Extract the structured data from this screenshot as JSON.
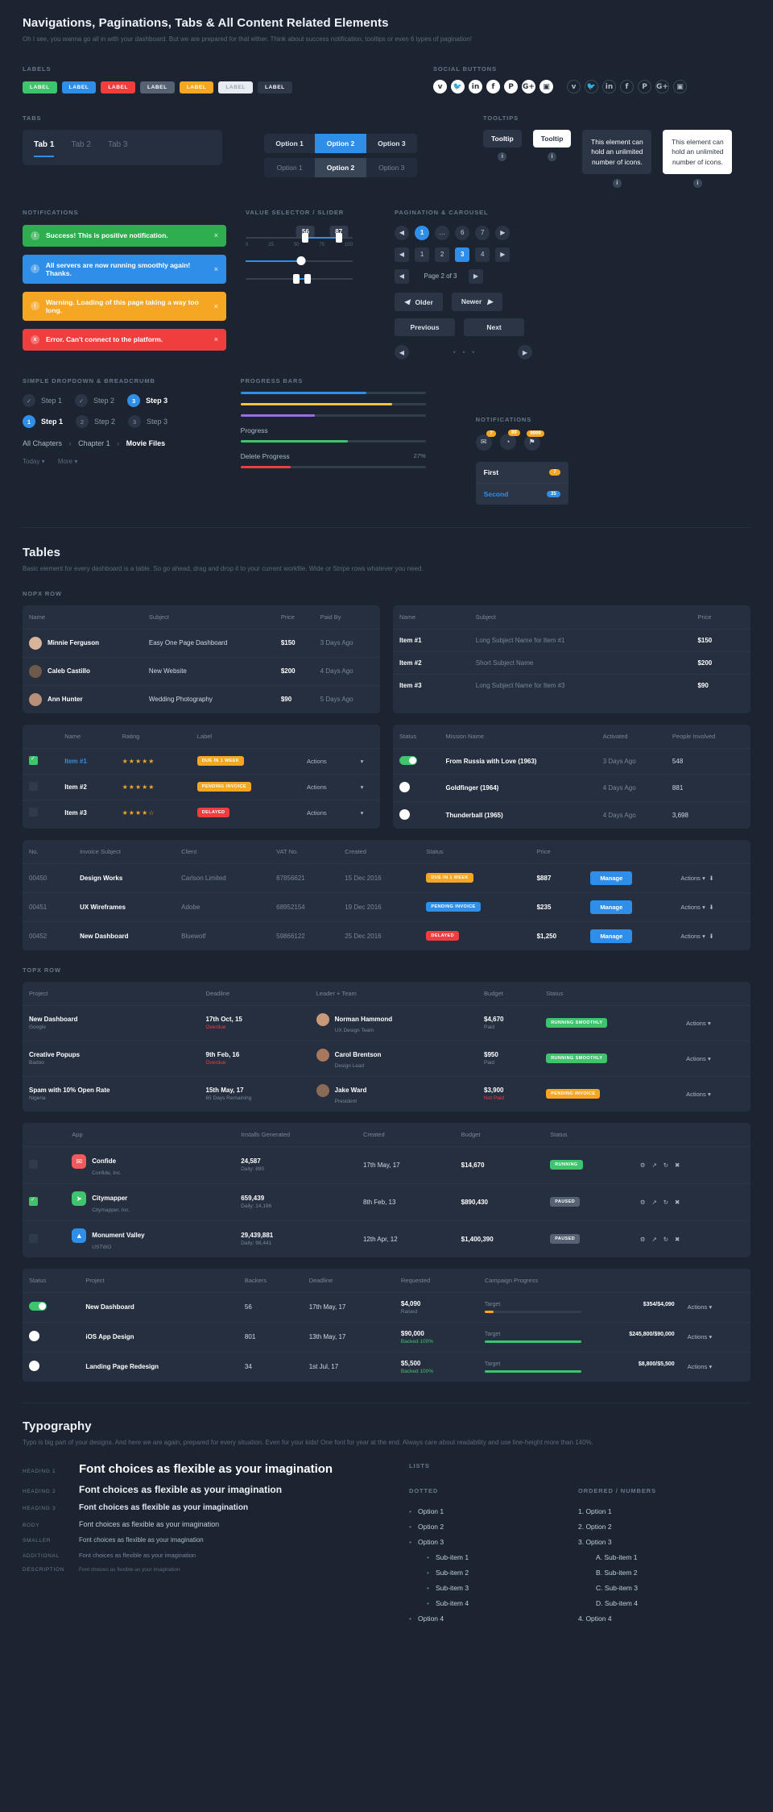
{
  "header": {
    "title": "Navigations, Paginations, Tabs & All Content Related Elements",
    "subtitle": "Oh I see, you wanna go all in with your dashboard. But we are prepared for that either. Think about success notification, tooltips or even 6 types of pagination!"
  },
  "sections": {
    "labels": "LABELS",
    "social": "SOCIAL BUTTONS",
    "tabs": "TABS",
    "tooltips": "TOOLTIPS",
    "notifications": "NOTIFICATIONS",
    "slider": "VALUE SELECTOR / SLIDER",
    "pagination": "PAGINATION & CAROUSEL",
    "dropdown": "SIMPLE DROPDOWN & BREADCRUMB",
    "progress": "PROGRESS BARS",
    "notifications2": "NOTIFICATIONS",
    "nopx": "NOPX ROW",
    "topx": "TOPX ROW"
  },
  "labels": [
    {
      "text": "LABEL",
      "color": "#3ec46d"
    },
    {
      "text": "LABEL",
      "color": "#2f8fe8"
    },
    {
      "text": "LABEL",
      "color": "#f03d3d"
    },
    {
      "text": "LABEL",
      "color": "#566274"
    },
    {
      "text": "LABEL",
      "color": "#f5a623"
    },
    {
      "text": "LABEL",
      "color": "#e8ecf1"
    },
    {
      "text": "LABEL",
      "color": "#2e3849"
    }
  ],
  "social_filled": [
    "v",
    "🐦",
    "in",
    "f",
    "P",
    "G+",
    "▣"
  ],
  "social_outline": [
    "v",
    "🐦",
    "in",
    "f",
    "P",
    "G+",
    "▣"
  ],
  "tabs": {
    "items": [
      "Tab 1",
      "Tab 2",
      "Tab 3"
    ],
    "active": "Tab 1"
  },
  "segments": {
    "row1": [
      "Option 1",
      "Option 2",
      "Option 3"
    ],
    "row2": [
      "Option 1",
      "Option 2",
      "Option 3"
    ],
    "active": "Option 2"
  },
  "tooltips": {
    "dark": "Tooltip",
    "light": "Tooltip",
    "big_dark": "This element can hold an unlimited number of icons.",
    "big_light": "This element can hold an unlimited number of icons."
  },
  "notifications": [
    {
      "text": "Success! This is positive notification.",
      "color": "#2fae4f",
      "icon": "i"
    },
    {
      "text": "All servers are now running smoothly again! Thanks.",
      "color": "#2f8fe8",
      "icon": "i"
    },
    {
      "text": "Warning. Loading of this page taking a way too long.",
      "color": "#f5a623",
      "icon": "i"
    },
    {
      "text": "Error. Can't connect to the platform.",
      "color": "#f03d3d",
      "icon": "x"
    }
  ],
  "slider": {
    "badge_left": "56",
    "badge_right": "87",
    "ticks": [
      "0",
      "25",
      "50",
      "75",
      "100"
    ],
    "range_low": 56,
    "range_high": 87,
    "single_value": 52,
    "pair_low": 47,
    "pair_high": 58
  },
  "pagination": {
    "row1": [
      "1",
      "…",
      "6",
      "7"
    ],
    "row2": [
      "1",
      "2",
      "3",
      "4"
    ],
    "page_label": "Page 2 of 3",
    "older": "Older",
    "newer": "Newer",
    "previous": "Previous",
    "next": "Next",
    "active1": "1",
    "active2": "3"
  },
  "steps": {
    "row1": [
      {
        "mark": "✓",
        "label": "Step 1",
        "on": false
      },
      {
        "mark": "✓",
        "label": "Step 2",
        "on": false
      },
      {
        "mark": "3",
        "label": "Step 3",
        "on": true
      }
    ],
    "row2": [
      {
        "mark": "1",
        "label": "Step 1",
        "on": true
      },
      {
        "mark": "2",
        "label": "Step 2",
        "on": false
      },
      {
        "mark": "3",
        "label": "Step 3",
        "on": false
      }
    ],
    "breadcrumb": [
      "All Chapters",
      "Chapter 1",
      "Movie Files"
    ],
    "dropdowns": [
      "Today",
      "More"
    ]
  },
  "progress_bars": [
    {
      "label": "",
      "pct": 68,
      "color": "#2f8fe8"
    },
    {
      "label": "",
      "pct": 82,
      "color": "#f5c542"
    },
    {
      "label": "",
      "pct": 40,
      "color": "#9b6ddf"
    },
    {
      "label": "Progress",
      "pct": 58,
      "color": "#3ec46d"
    },
    {
      "label": "Delete Progress",
      "pct": 27,
      "value": "27%",
      "color": "#f03d3d"
    }
  ],
  "notif_badges": [
    {
      "icon": "✉",
      "count": "7",
      "color": "#f5a623"
    },
    {
      "icon": "◔",
      "count": "89",
      "color": "#f5a623"
    },
    {
      "icon": "⚑",
      "count": "9999",
      "color": "#f5a623"
    }
  ],
  "notif_list": [
    {
      "label": "First",
      "count": "7",
      "color": "#f5a623",
      "active": false
    },
    {
      "label": "Second",
      "count": "35",
      "color": "#2f8fe8",
      "active": true
    }
  ],
  "tables_header": {
    "title": "Tables",
    "subtitle": "Basic element for every dashboard is a table. So go ahead, drag and drop it to your current workfile. Wide or Stripe rows whatever you need."
  },
  "table1": {
    "columns": [
      "Name",
      "Subject",
      "Price",
      "Paid By"
    ],
    "rows": [
      {
        "name": "Minnie Ferguson",
        "subject": "Easy One Page Dashboard",
        "price": "$150",
        "paid": "3 Days Ago",
        "av": "#d8b49a"
      },
      {
        "name": "Caleb Castillo",
        "subject": "New Website",
        "price": "$200",
        "paid": "4 Days Ago",
        "av": "#6d5a4a"
      },
      {
        "name": "Ann Hunter",
        "subject": "Wedding Photography",
        "price": "$90",
        "paid": "5 Days Ago",
        "av": "#b98f78"
      }
    ]
  },
  "table2": {
    "columns": [
      "Name",
      "Subject",
      "Price"
    ],
    "rows": [
      {
        "name": "Item #1",
        "subject": "Long Subject Name for Item #1",
        "price": "$150"
      },
      {
        "name": "Item #2",
        "subject": "Short Subject Name",
        "price": "$200"
      },
      {
        "name": "Item #3",
        "subject": "Long Subject Name for Item #3",
        "price": "$90"
      }
    ]
  },
  "table3": {
    "columns": [
      "",
      "Name",
      "Rating",
      "Label",
      "",
      ""
    ],
    "rows": [
      {
        "checked": true,
        "name": "Item #1",
        "rating": "★★★★★",
        "chip": "DUE IN 1 WEEK",
        "chip_color": "#f5a623",
        "actions": "Actions"
      },
      {
        "checked": false,
        "name": "Item #2",
        "rating": "★★★★★",
        "chip": "PENDING INVOICE",
        "chip_color": "#f5a623",
        "actions": "Actions"
      },
      {
        "checked": false,
        "name": "Item #3",
        "rating": "★★★★☆",
        "chip": "DELAYED",
        "chip_color": "#f03d3d",
        "actions": "Actions"
      }
    ]
  },
  "table4": {
    "columns": [
      "Status",
      "Mission Name",
      "Activated",
      "People Involved"
    ],
    "rows": [
      {
        "toggle": "on",
        "mission": "From Russia with Love (1963)",
        "activated": "3 Days Ago",
        "people": "548"
      },
      {
        "toggle": "radio",
        "mission": "Goldfinger (1964)",
        "activated": "4 Days Ago",
        "people": "881"
      },
      {
        "toggle": "radio",
        "mission": "Thunderball (1965)",
        "activated": "4 Days Ago",
        "people": "3,698"
      }
    ]
  },
  "table5": {
    "columns": [
      "No.",
      "Invoice Subject",
      "Client",
      "VAT No.",
      "Created",
      "Status",
      "Price",
      "",
      ""
    ],
    "rows": [
      {
        "no": "00450",
        "subject": "Design Works",
        "client": "Carlson Limited",
        "vat": "87856621",
        "created": "15 Dec 2016",
        "chip": "DUE IN 1 WEEK",
        "chip_color": "#f5a623",
        "price": "$887",
        "manage": "Manage",
        "actions": "Actions"
      },
      {
        "no": "00451",
        "subject": "UX Wireframes",
        "client": "Adobe",
        "vat": "68952154",
        "created": "19 Dec 2016",
        "chip": "PENDING INVOICE",
        "chip_color": "#2f8fe8",
        "price": "$235",
        "manage": "Manage",
        "actions": "Actions"
      },
      {
        "no": "00452",
        "subject": "New Dashboard",
        "client": "Bluewolf",
        "vat": "59866122",
        "created": "25 Dec 2016",
        "chip": "DELAYED",
        "chip_color": "#f03d3d",
        "price": "$1,250",
        "manage": "Manage",
        "actions": "Actions"
      }
    ]
  },
  "table6": {
    "columns": [
      "Project",
      "Deadline",
      "Leader + Team",
      "Budget",
      "Status",
      ""
    ],
    "rows": [
      {
        "project": "New Dashboard",
        "sub": "Google",
        "deadline": "17th Oct, 15",
        "dsub": "Overdue",
        "dsub_color": "#f03d3d",
        "leader": "Norman Hammond",
        "lsub": "UX Design Team",
        "budget": "$4,670",
        "bsub": "Paid",
        "bsub_color": "#7a8599",
        "chip": "RUNNING SMOOTHLY",
        "chip_color": "#3ec46d",
        "actions": "Actions",
        "av": "#c89a7a"
      },
      {
        "project": "Creative Popups",
        "sub": "Badoo",
        "deadline": "9th Feb, 16",
        "dsub": "Overdue",
        "dsub_color": "#f03d3d",
        "leader": "Carol Brentson",
        "lsub": "Design Lead",
        "budget": "$950",
        "bsub": "Paid",
        "bsub_color": "#7a8599",
        "chip": "RUNNING SMOOTHLY",
        "chip_color": "#3ec46d",
        "actions": "Actions",
        "av": "#a8785c"
      },
      {
        "project": "Spam with 10% Open Rate",
        "sub": "Nigeria",
        "deadline": "15th May, 17",
        "dsub": "65 Days Remaining",
        "dsub_color": "#7a8599",
        "leader": "Jake Ward",
        "lsub": "President",
        "budget": "$3,900",
        "bsub": "Not Paid",
        "bsub_color": "#f03d3d",
        "chip": "PENDING INVOICE",
        "chip_color": "#f5a623",
        "actions": "Actions",
        "av": "#8a6a55"
      }
    ]
  },
  "table7": {
    "columns": [
      "",
      "App",
      "Installs Generated",
      "Created",
      "Budget",
      "Status",
      ""
    ],
    "rows": [
      {
        "checked": false,
        "app": "Confide",
        "sub": "Confide, Inc.",
        "installs": "24,587",
        "isub": "Daily: 890",
        "created": "17th May, 17",
        "budget": "$14,670",
        "chip": "RUNNING",
        "chip_color": "#3ec46d",
        "icon_color": "#f05a5a",
        "glyph": "✉"
      },
      {
        "checked": true,
        "app": "Citymapper",
        "sub": "Citymapper, Inc.",
        "installs": "659,439",
        "isub": "Daily: 14,196",
        "created": "8th Feb, 13",
        "budget": "$890,430",
        "chip": "PAUSED",
        "chip_color": "#566274",
        "icon_color": "#3ec46d",
        "glyph": "➤"
      },
      {
        "checked": false,
        "app": "Monument Valley",
        "sub": "USTWO",
        "installs": "29,439,881",
        "isub": "Daily: 98,441",
        "created": "12th Apr, 12",
        "budget": "$1,400,390",
        "chip": "PAUSED",
        "chip_color": "#566274",
        "icon_color": "#2f8fe8",
        "glyph": "▲"
      }
    ]
  },
  "table8": {
    "columns": [
      "Status",
      "Project",
      "Backers",
      "Deadline",
      "Requested",
      "Campaign Progress",
      ""
    ],
    "rows": [
      {
        "toggle": "on",
        "project": "New Dashboard",
        "backers": "56",
        "deadline": "17th May, 17",
        "requested": "$4,090",
        "rsub": "Raised",
        "rsub_color": "#7a8599",
        "target": "Target",
        "amount": "$354/$4,090",
        "pct": 9,
        "bar_color": "#f5a623",
        "actions": "Actions"
      },
      {
        "toggle": "radio",
        "project": "iOS App Design",
        "backers": "801",
        "deadline": "13th May, 17",
        "requested": "$90,000",
        "rsub": "Backed 100%",
        "rsub_color": "#3ec46d",
        "target": "Target",
        "amount": "$245,800/$90,000",
        "pct": 100,
        "bar_color": "#3ec46d",
        "actions": "Actions"
      },
      {
        "toggle": "radio",
        "project": "Landing Page Redesign",
        "backers": "34",
        "deadline": "1st Jul, 17",
        "requested": "$5,500",
        "rsub": "Backed 100%",
        "rsub_color": "#3ec46d",
        "target": "Target",
        "amount": "$8,800/$5,500",
        "pct": 100,
        "bar_color": "#3ec46d",
        "actions": "Actions"
      }
    ]
  },
  "typography": {
    "title": "Typography",
    "subtitle": "Typo is big part of your designs. And here we are again, prepared for every situation. Even for your kids! One font for year at the end. Always care about readability and use line-height more than 140%.",
    "rows": [
      {
        "key": "HEADING 1",
        "text": "Font choices as flexible as your imagination",
        "size": "15px",
        "weight": "bold",
        "color": "#ffffff"
      },
      {
        "key": "HEADING 2",
        "text": "Font choices as flexible as your imagination",
        "size": "12px",
        "weight": "bold",
        "color": "#eef2f7"
      },
      {
        "key": "HEADING 3",
        "text": "Font choices as flexible as your imagination",
        "size": "10px",
        "weight": "bold",
        "color": "#dfe5ee"
      },
      {
        "key": "BODY",
        "text": "Font choices as flexible as your imagination",
        "size": "9px",
        "weight": "normal",
        "color": "#c3ccda"
      },
      {
        "key": "SMALLER",
        "text": "Font choices as flexible as your imagination",
        "size": "8px",
        "weight": "normal",
        "color": "#aeb8c6"
      },
      {
        "key": "ADDITIONAL",
        "text": "Font choices as flexible as your imagination",
        "size": "7.5px",
        "weight": "normal",
        "color": "#7a8599"
      },
      {
        "key": "DESCRIPTION",
        "text": "Font choices as flexible as your imagination",
        "size": "6.5px",
        "weight": "normal",
        "color": "#5d6878"
      }
    ],
    "lists_title": "LISTS",
    "dotted_title": "DOTTED",
    "ordered_title": "ORDERED / NUMBERS",
    "dotted": [
      "Option 1",
      "Option 2",
      "Option 3"
    ],
    "dotted_sub": [
      "Sub-item 1",
      "Sub-item 2",
      "Sub-item 3",
      "Sub-item 4"
    ],
    "dotted_last": "Option 4",
    "ordered": [
      "1.  Option 1",
      "2.  Option 2",
      "3.  Option 3"
    ],
    "ordered_sub": [
      "A.  Sub-item 1",
      "B.  Sub-item 2",
      "C.  Sub-item 3",
      "D.  Sub-item 4"
    ],
    "ordered_last": "4.  Option 4"
  }
}
